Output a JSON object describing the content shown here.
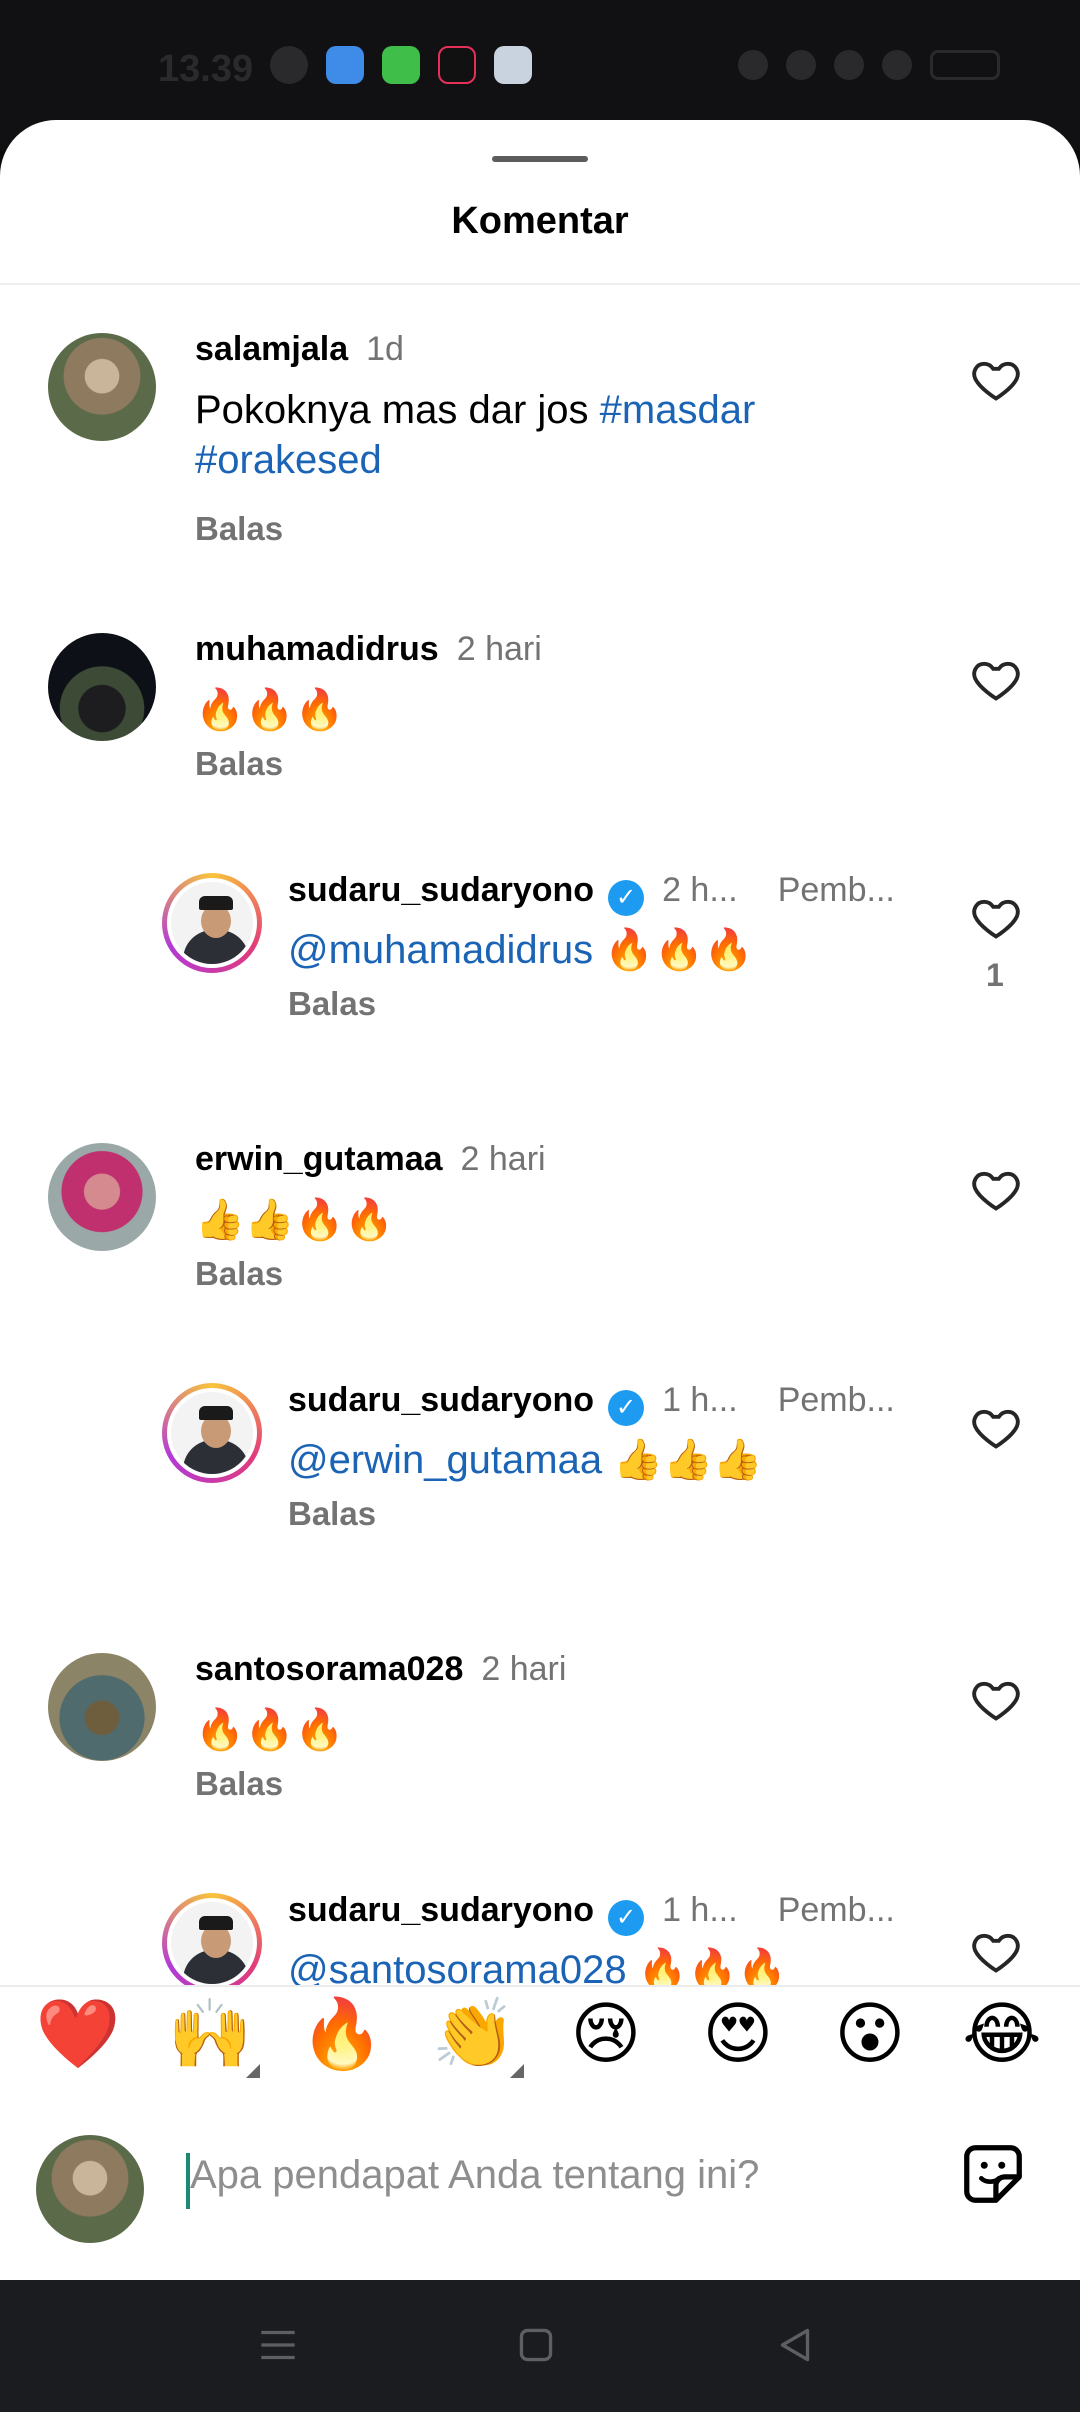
{
  "status_bar": {
    "time": "13.39"
  },
  "sheet": {
    "title": "Komentar"
  },
  "comments": [
    {
      "username": "salamjala",
      "time": "1d",
      "text_prefix": "Pokoknya mas dar jos ",
      "tag1": "#masdar",
      "tag2": "#orakesed",
      "reply": "Balas"
    },
    {
      "username": "muhamadidrus",
      "time": "2 hari",
      "text": "🔥🔥🔥",
      "reply": "Balas"
    },
    {
      "username": "sudaru_sudaryono",
      "time": "2 h...",
      "author": "Pemb...",
      "mention": "@muhamadidrus",
      "text": " 🔥🔥🔥",
      "reply": "Balas",
      "likes": "1"
    },
    {
      "username": "erwin_gutamaa",
      "time": "2 hari",
      "text": "👍👍🔥🔥",
      "reply": "Balas"
    },
    {
      "username": "sudaru_sudaryono",
      "time": "1 h...",
      "author": "Pemb...",
      "mention": "@erwin_gutamaa",
      "text": " 👍👍👍",
      "reply": "Balas"
    },
    {
      "username": "santosorama028",
      "time": "2 hari",
      "text": "🔥🔥🔥",
      "reply": "Balas"
    },
    {
      "username": "sudaru_sudaryono",
      "time": "1 h...",
      "author": "Pemb...",
      "mention": "@santosorama028",
      "text": " 🔥🔥🔥"
    }
  ],
  "emoji_bar": [
    "❤️",
    "🙌",
    "🔥",
    "👏",
    "😢",
    "😍",
    "😮",
    "😂"
  ],
  "input": {
    "placeholder": "Apa pendapat Anda tentang ini?"
  },
  "colors": {
    "link": "#1a63b5",
    "muted": "#737373"
  }
}
